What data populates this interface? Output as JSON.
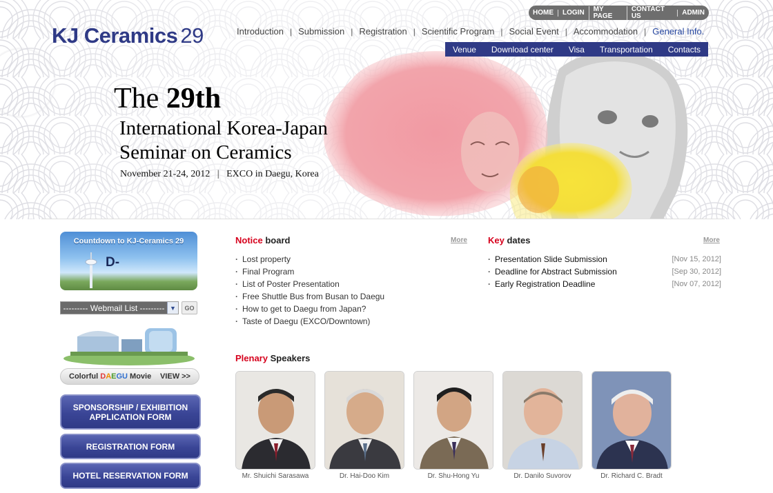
{
  "logo": {
    "brand": "KJ Ceramics",
    "number": "29"
  },
  "util_nav": [
    "HOME",
    "LOGIN",
    "MY PAGE",
    "CONTACT US",
    "ADMIN"
  ],
  "main_nav": [
    "Introduction",
    "Submission",
    "Registration",
    "Scientific Program",
    "Social Event",
    "Accommodation",
    "General Info."
  ],
  "main_nav_active": "General Info.",
  "sub_nav": [
    "Venue",
    "Download center",
    "Visa",
    "Transportation",
    "Contacts"
  ],
  "hero": {
    "title_the": "The",
    "title_num": "29th",
    "subtitle_line1": "International Korea-Japan",
    "subtitle_line2": "Seminar on Ceramics",
    "date": "November 21-24, 2012",
    "location": "EXCO in Daegu, Korea"
  },
  "sidebar": {
    "countdown_title": "Countdown to KJ-Ceramics 29",
    "countdown_value": "D-",
    "webmail_label": "--------- Webmail List ---------",
    "go_label": "GO",
    "movie_prefix": "Colorful",
    "movie_city": "DAEGU",
    "movie_suffix": "Movie",
    "movie_view": "VIEW >>",
    "btn_sponsor_line1": "SPONSORSHIP / EXHIBITION",
    "btn_sponsor_line2": "APPLICATION FORM",
    "btn_registration": "REGISTRATION FORM",
    "btn_hotel": "HOTEL RESERVATION FORM"
  },
  "notice": {
    "title_red": "Notice",
    "title_rest": " board",
    "more": "More",
    "items": [
      "Lost property",
      "Final Program",
      "List of Poster Presentation",
      "Free Shuttle Bus from Busan to Daegu",
      "How to get to Daegu from Japan?",
      "Taste of Daegu (EXCO/Downtown)"
    ]
  },
  "key_dates": {
    "title_red": "Key",
    "title_rest": " dates",
    "more": "More",
    "items": [
      {
        "title": "Presentation Slide Submission",
        "date": "[Nov 15, 2012]"
      },
      {
        "title": "Deadline for Abstract Submission",
        "date": "[Sep 30, 2012]"
      },
      {
        "title": "Early Registration Deadline",
        "date": "[Nov 07, 2012]"
      }
    ]
  },
  "plenary": {
    "title_red": "Plenary",
    "title_rest": " Speakers",
    "speakers": [
      "Mr. Shuichi Sarasawa",
      "Dr. Hai-Doo Kim",
      "Dr. Shu-Hong Yu",
      "Dr. Danilo Suvorov",
      "Dr. Richard C. Bradt"
    ]
  },
  "colors": {
    "brand_navy": "#2f3a86",
    "accent_red": "#d6001c",
    "util_gray": "#6e6e6e",
    "active_blue": "#2546a0"
  }
}
